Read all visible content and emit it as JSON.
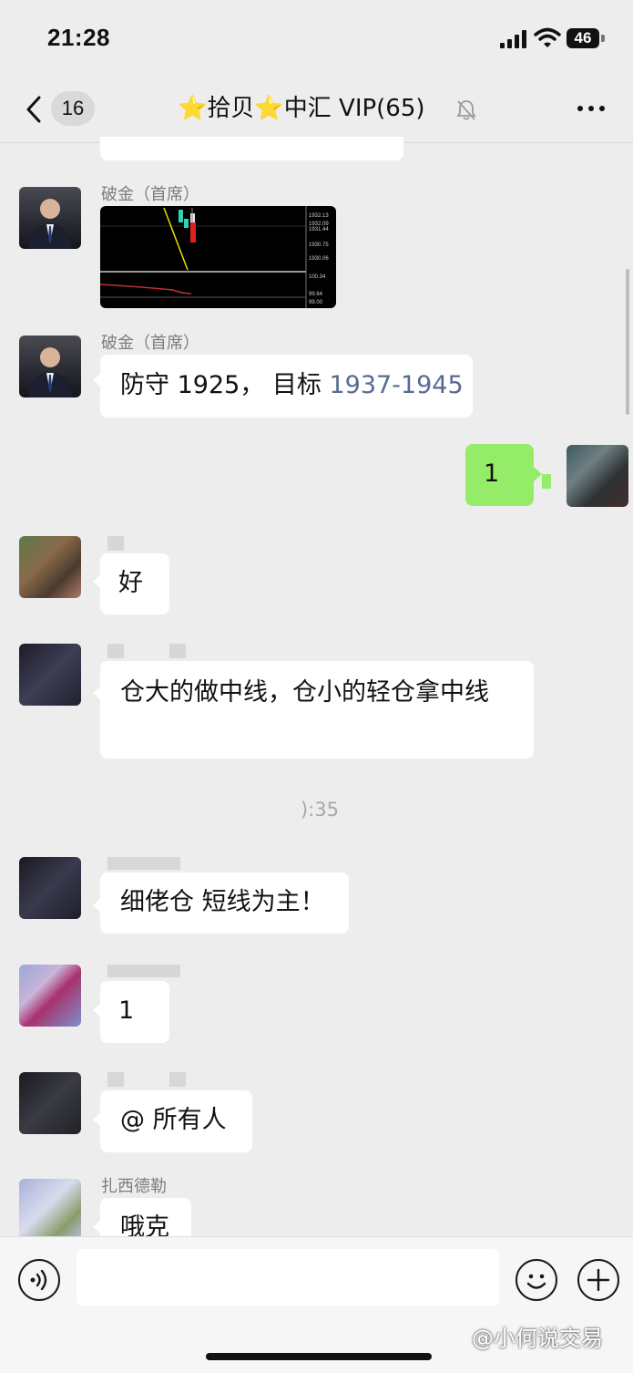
{
  "status_bar": {
    "time": "21:28",
    "battery": "46"
  },
  "nav": {
    "unread_count": "16",
    "title_part1": "拾贝",
    "title_part2": "中汇 VIP(65)"
  },
  "messages": {
    "m1_sender": "破金（首席）",
    "m1_chart_prices": [
      "1932.13",
      "1932.09",
      "1931.44",
      "1930.75",
      "1930.06",
      "100.34",
      "99.64",
      "99.00"
    ],
    "m2_sender": "破金（首席）",
    "m2_text_plain": "防守 1925， 目标 ",
    "m2_text_link": "1937-1945",
    "m3_text": "1",
    "m4_text": "好",
    "m5_text": "仓大的做中线，仓小的轻仓拿中线",
    "timestamp": "):35",
    "m6_text": "细佬仓 短线为主！",
    "m7_text": "1",
    "m8_text": "@ 所有人",
    "m9_sender": "扎西德勒",
    "m9_text": "哦克"
  },
  "input": {
    "placeholder": ""
  },
  "watermark": "@小何说交易",
  "colors": {
    "green_bubble": "#95ec69",
    "link": "#576b95",
    "background": "#ededed"
  }
}
